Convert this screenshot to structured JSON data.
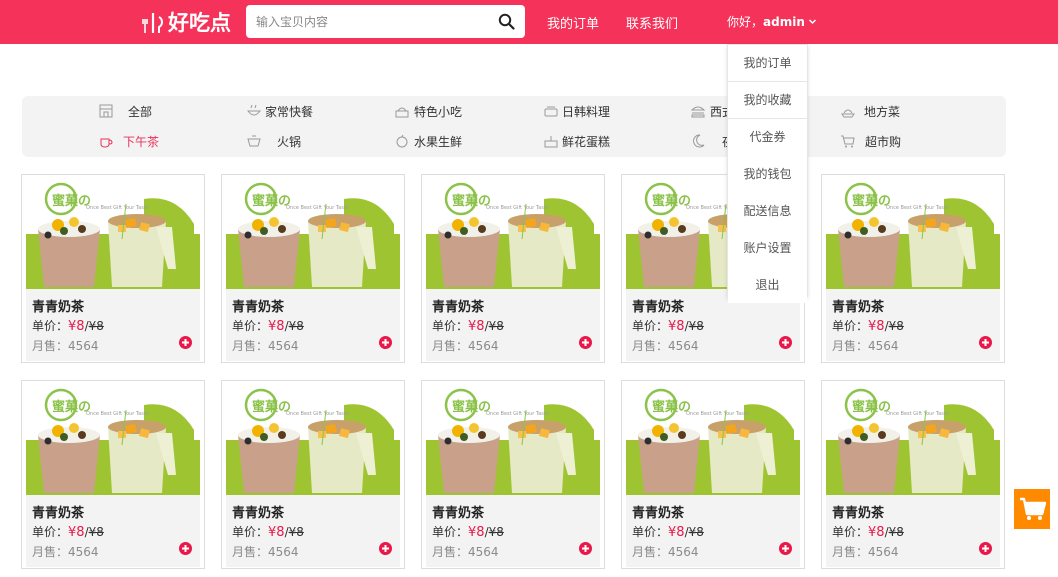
{
  "header": {
    "logo_text": "好吃点",
    "search_placeholder": "输入宝贝内容",
    "nav_orders": "我的订单",
    "nav_contact": "联系我们",
    "greeting": "你好，",
    "username": "admin"
  },
  "categories": [
    {
      "label": "全部",
      "icon": "store-icon"
    },
    {
      "label": "家常快餐",
      "icon": "bowl-icon"
    },
    {
      "label": "特色小吃",
      "icon": "cake-icon"
    },
    {
      "label": "日韩料理",
      "icon": "sushi-icon"
    },
    {
      "label": "西式快餐",
      "icon": "burger-icon"
    },
    {
      "label": "地方菜",
      "icon": "dish-icon"
    },
    {
      "label": "下午茶",
      "icon": "teacup-icon",
      "active": true
    },
    {
      "label": "火锅",
      "icon": "pot-icon"
    },
    {
      "label": "水果生鲜",
      "icon": "fruit-icon"
    },
    {
      "label": "鲜花蛋糕",
      "icon": "birthday-cake-icon"
    },
    {
      "label": "夜宵",
      "icon": "moon-icon"
    },
    {
      "label": "超市购",
      "icon": "cart-icon"
    }
  ],
  "dropdown": {
    "items": [
      "我的订单",
      "我的收藏",
      "代金券",
      "我的钱包",
      "配送信息",
      "账户设置",
      "退出"
    ]
  },
  "product_template": {
    "name": "青青奶茶",
    "price_label": "单价：",
    "price_now": "¥8",
    "price_sep": "/",
    "price_old": "¥8",
    "sales": "月售：4564",
    "brand_text": "蜜菓の",
    "brand_sub": "Once Best Gift Your Taste"
  },
  "products": [
    {
      "name": "青青奶茶",
      "price_label": "单价：",
      "price_now": "¥8",
      "price_sep": "/",
      "price_old": "¥8",
      "sales": "月售：4564"
    },
    {
      "name": "青青奶茶",
      "price_label": "单价：",
      "price_now": "¥8",
      "price_sep": "/",
      "price_old": "¥8",
      "sales": "月售：4564"
    },
    {
      "name": "青青奶茶",
      "price_label": "单价：",
      "price_now": "¥8",
      "price_sep": "/",
      "price_old": "¥8",
      "sales": "月售：4564"
    },
    {
      "name": "青青奶茶",
      "price_label": "单价：",
      "price_now": "¥8",
      "price_sep": "/",
      "price_old": "¥8",
      "sales": "月售：4564"
    },
    {
      "name": "青青奶茶",
      "price_label": "单价：",
      "price_now": "¥8",
      "price_sep": "/",
      "price_old": "¥8",
      "sales": "月售：4564"
    },
    {
      "name": "青青奶茶",
      "price_label": "单价：",
      "price_now": "¥8",
      "price_sep": "/",
      "price_old": "¥8",
      "sales": "月售：4564"
    },
    {
      "name": "青青奶茶",
      "price_label": "单价：",
      "price_now": "¥8",
      "price_sep": "/",
      "price_old": "¥8",
      "sales": "月售：4564"
    },
    {
      "name": "青青奶茶",
      "price_label": "单价：",
      "price_now": "¥8",
      "price_sep": "/",
      "price_old": "¥8",
      "sales": "月售：4564"
    },
    {
      "name": "青青奶茶",
      "price_label": "单价：",
      "price_now": "¥8",
      "price_sep": "/",
      "price_old": "¥8",
      "sales": "月售：4564"
    },
    {
      "name": "青青奶茶",
      "price_label": "单价：",
      "price_now": "¥8",
      "price_sep": "/",
      "price_old": "¥8",
      "sales": "月售：4564"
    }
  ],
  "colors": {
    "brand": "#f5335a",
    "price": "#e8184a",
    "cart_button": "#ff8a00",
    "product_green": "#9ec531"
  }
}
